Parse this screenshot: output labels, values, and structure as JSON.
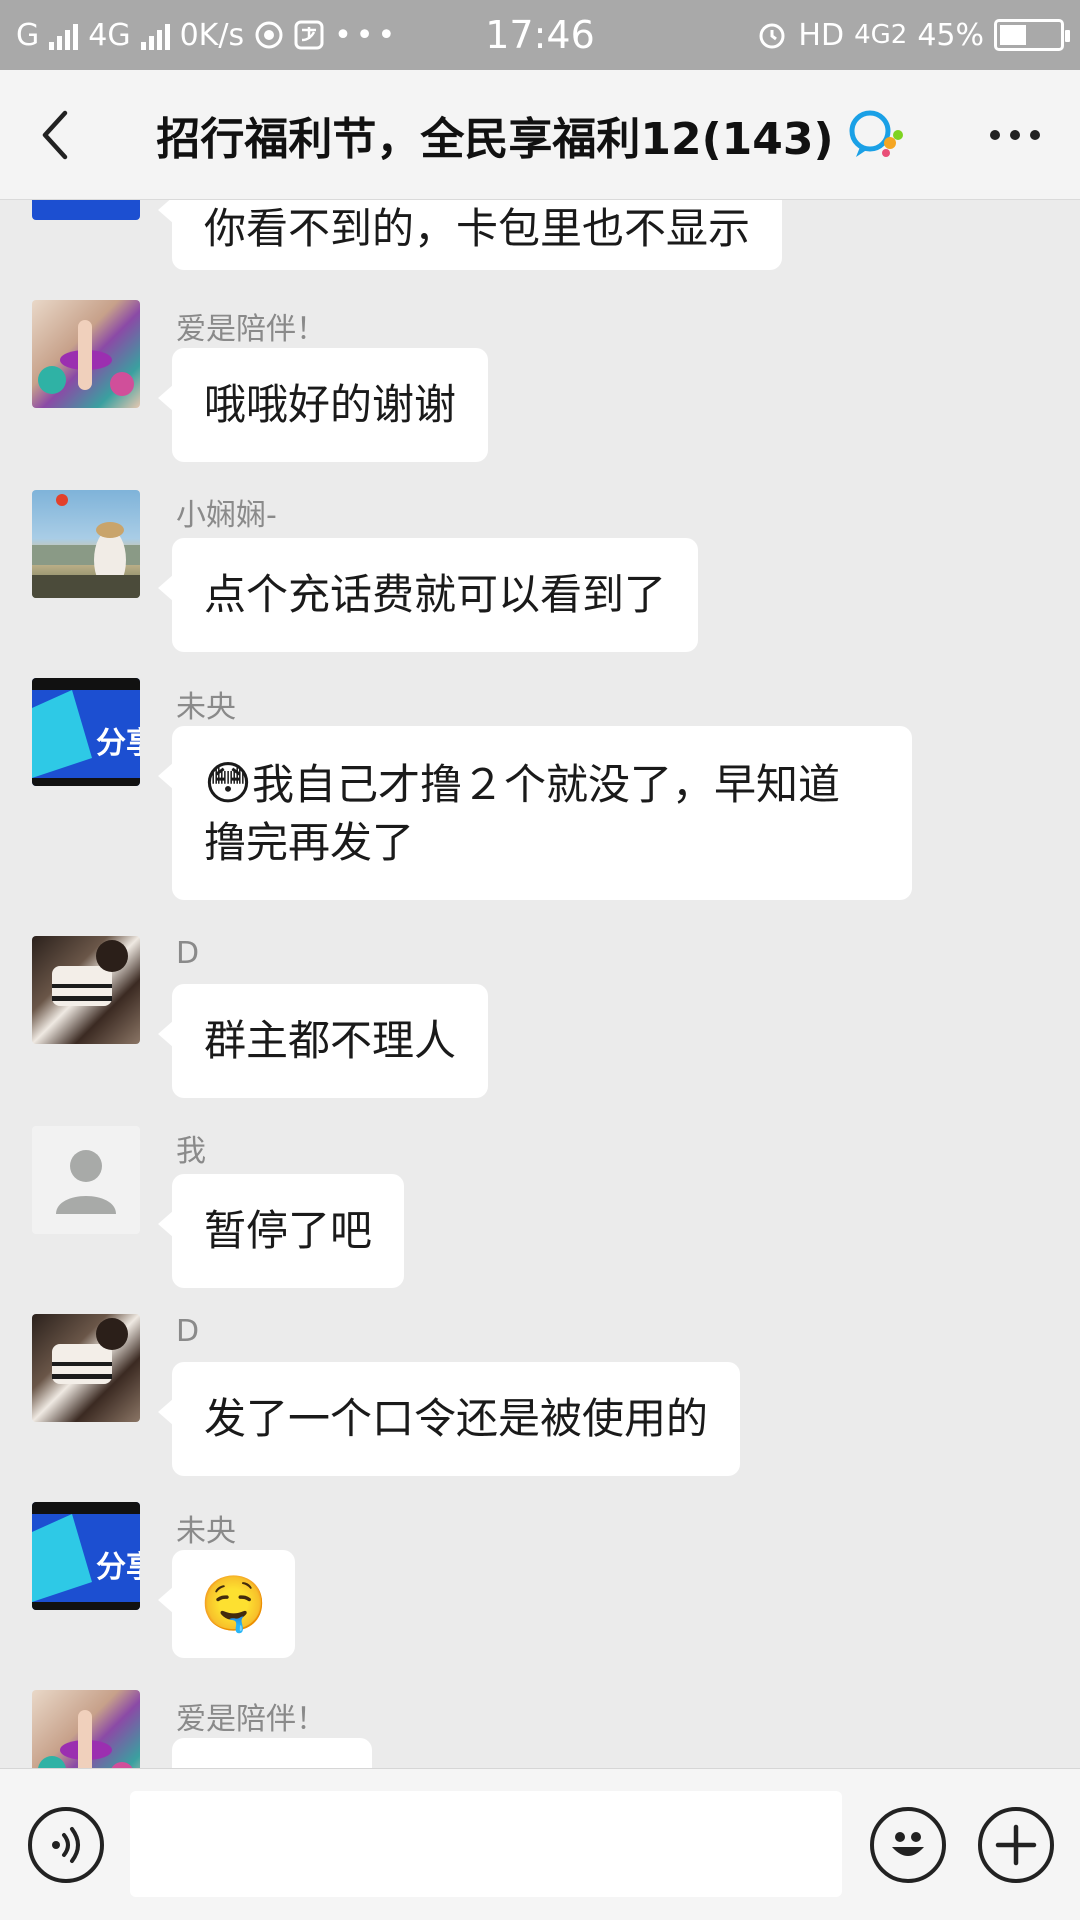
{
  "status_bar": {
    "network_1": "G",
    "network_2": "4G",
    "speed": "0K/s",
    "time": "17:46",
    "hd": "HD",
    "network_3": "4G2",
    "battery_percent": "45%",
    "battery_level": 0.45
  },
  "header": {
    "title": "招行福利节，全民享福利12(143)"
  },
  "messages": [
    {
      "sender": "",
      "text": "你看不到的，卡包里也不显示",
      "avatar": "share-avatar"
    },
    {
      "sender": "爱是陪伴！",
      "text": "哦哦好的谢谢",
      "avatar": "lips-avatar"
    },
    {
      "sender": "小娴娴-",
      "text": "点个充话费就可以看到了",
      "avatar": "travel-avatar"
    },
    {
      "sender": "未央",
      "text": "我自己才撸２个就没了，早知道撸完再发了",
      "text_line1": "我自己才撸２个就没了，早知道",
      "text_line2": "撸完再发了",
      "emoji": "😳",
      "avatar": "share-avatar"
    },
    {
      "sender": "D",
      "text": "群主都不理人",
      "avatar": "d-avatar"
    },
    {
      "sender": "我",
      "text": "暂停了吧",
      "avatar": "default-avatar"
    },
    {
      "sender": "D",
      "text": "发了一个口令还是被使用的",
      "avatar": "d-avatar"
    },
    {
      "sender": "未央",
      "text": "",
      "emoji": "🤤",
      "avatar": "share-avatar"
    },
    {
      "sender": "爱是陪伴！",
      "text": "",
      "avatar": "lips-avatar"
    }
  ],
  "share_avatar_text": "分享",
  "input": {
    "placeholder": "",
    "value": ""
  },
  "colors": {
    "status_bar": "#a9a9a9",
    "background": "#ebebeb",
    "bubble": "#ffffff",
    "share_blue": "#1c4fd1"
  }
}
